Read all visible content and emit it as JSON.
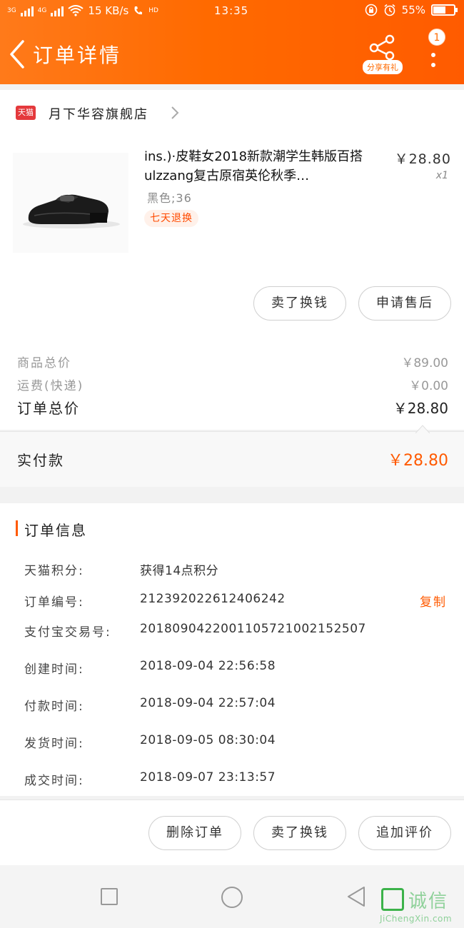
{
  "status_bar": {
    "network": "3G",
    "network2": "4G",
    "speed": "15 KB/s",
    "hd": "HD",
    "time": "13:35",
    "battery": "55%"
  },
  "header": {
    "title": "订单详情",
    "share_label": "分享有礼",
    "badge": "1"
  },
  "shop": {
    "platform_badge": "天猫",
    "name": "月下华容旗舰店"
  },
  "product": {
    "title": "ins.)·皮鞋女2018新款潮学生韩版百搭ulzzang复古原宿英伦秋季…",
    "price": "￥28.80",
    "qty": "x1",
    "sku": "黑色;36",
    "tag": "七天退换"
  },
  "actions_top": {
    "sell": "卖了换钱",
    "after_sale": "申请售后"
  },
  "summary": {
    "goods_total_label": "商品总价",
    "goods_total_value": "￥89.00",
    "shipping_label": "运费(快递)",
    "shipping_value": "￥0.00",
    "order_total_label": "订单总价",
    "order_total_value": "￥28.80"
  },
  "paid": {
    "label": "实付款",
    "value": "￥28.80"
  },
  "order_info": {
    "title": "订单信息",
    "rows": [
      {
        "key": "天猫积分:",
        "value": "获得14点积分"
      },
      {
        "key": "订单编号:",
        "value": "212392022612406242"
      },
      {
        "key": "支付宝交易号:",
        "value": "2018090422001105721002152507"
      },
      {
        "key": "创建时间:",
        "value": "2018-09-04 22:56:58"
      },
      {
        "key": "付款时间:",
        "value": "2018-09-04 22:57:04"
      },
      {
        "key": "发货时间:",
        "value": "2018-09-05 08:30:04"
      },
      {
        "key": "成交时间:",
        "value": "2018-09-07 23:13:57"
      }
    ],
    "copy_label": "复制"
  },
  "actions_bottom": {
    "delete": "删除订单",
    "sell": "卖了换钱",
    "review": "追加评价"
  },
  "watermark": {
    "text": "诚信",
    "url": "JiChengXin.com"
  },
  "colors": {
    "accent": "#ff5a00",
    "header_start": "#ff7a1a",
    "header_end": "#ff5b00",
    "tmall_red": "#e4393c"
  }
}
